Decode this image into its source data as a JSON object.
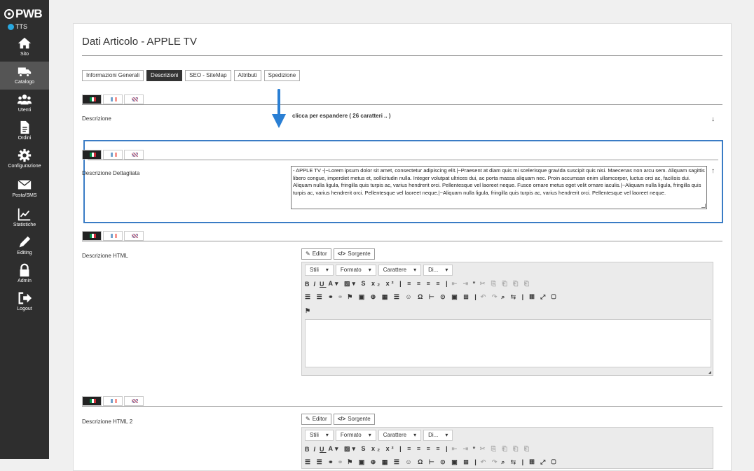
{
  "sidebar": {
    "logo": "PWB",
    "site_badge": "TTS",
    "items": [
      {
        "label": "Sito",
        "icon": "home-icon"
      },
      {
        "label": "Catalogo",
        "icon": "truck-icon"
      },
      {
        "label": "Utenti",
        "icon": "users-icon"
      },
      {
        "label": "Ordini",
        "icon": "document-icon"
      },
      {
        "label": "Configurazione",
        "icon": "gear-icon"
      },
      {
        "label": "Posta/SMS",
        "icon": "envelope-icon"
      },
      {
        "label": "Statistiche",
        "icon": "chart-icon"
      },
      {
        "label": "Editing",
        "icon": "pencil-icon"
      },
      {
        "label": "Admin",
        "icon": "lock-icon"
      },
      {
        "label": "Logout",
        "icon": "logout-icon"
      }
    ],
    "active_item": "Catalogo"
  },
  "page": {
    "title": "Dati Articolo - APPLE TV",
    "tabs": [
      "Informazioni Generali",
      "Descrizioni",
      "SEO - SiteMap",
      "Attributi",
      "Spedizione"
    ],
    "active_tab": "Descrizioni"
  },
  "fields": {
    "descrizione": {
      "label": "Descrizione",
      "hint": "clicca per espandere ( 26 caratteri .. )",
      "toggle": "↓"
    },
    "descrizione_dettagliata": {
      "label": "Descrizione Dettagliata",
      "value": "- APPLE TV -|~Lorem ipsum dolor sit amet, consectetur adipiscing elit.|~Praesent at diam quis mi scelerisque gravida suscipit quis nisi. Maecenas non arcu sem. Aliquam sagittis libero congue, imperdiet metus et, sollicitudin nulla. Integer volutpat ultrices dui, ac porta massa aliquam nec. Proin accumsan enim ullamcorper, luctus orci ac, facilisis dui. Aliquam nulla ligula, fringilla quis turpis ac, varius hendrerit orci. Pellentesque vel laoreet neque. Fusce ornare metus eget velit ornare iaculis.|~Aliquam nulla ligula, fringilla quis turpis ac, varius hendrerit orci. Pellentesque vel laoreet neque.|~Aliquam nulla ligula, fringilla quis turpis ac, varius hendrerit orci. Pellentesque vel laoreet neque.",
      "toggle": "↑"
    },
    "descrizione_html": {
      "label": "Descrizione HTML"
    },
    "descrizione_html_2": {
      "label": "Descrizione HTML 2"
    }
  },
  "editor": {
    "editor_button": "Editor",
    "source_button": "Sorgente",
    "dropdowns": [
      "Stili",
      "Formato",
      "Carattere",
      "Di..."
    ]
  },
  "colors": {
    "sidebar_bg": "#2e2e2e",
    "highlight_border": "#3a7cc5",
    "annotation_arrow": "#2a7fd4",
    "active_tab_bg": "#333333"
  }
}
